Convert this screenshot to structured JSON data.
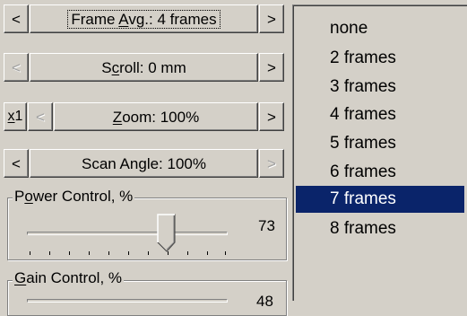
{
  "frame_avg": {
    "prev": "<",
    "label": "Frame Avg.: 4 frames",
    "next": ">"
  },
  "scroll": {
    "prev": "<",
    "label": "Scroll: 0 mm",
    "next": ">"
  },
  "zoom": {
    "x1": "x1",
    "prev": "<",
    "label": "Zoom: 100%",
    "next": ">"
  },
  "scan_angle": {
    "prev": "<",
    "label": "Scan Angle: 100%",
    "next": ">"
  },
  "power": {
    "title": "Power Control, %",
    "value": "73",
    "level": 0.73
  },
  "gain": {
    "title": "Gain Control, %",
    "value": "48"
  },
  "dropdown": {
    "selected": "7 frames",
    "options": [
      "none",
      "2 frames",
      "3 frames",
      "4 frames",
      "5 frames",
      "6 frames",
      "7 frames",
      "8 frames"
    ]
  },
  "colors": {
    "face": "#d4d0c8",
    "highlight": "#0a246a"
  }
}
